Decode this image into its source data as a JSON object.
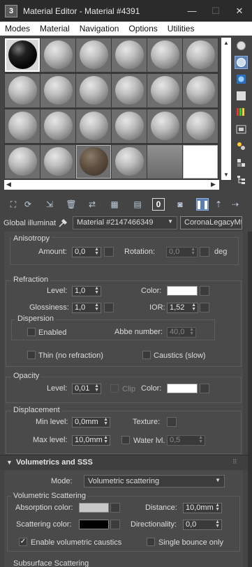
{
  "window": {
    "title": "Material Editor - Material #4391",
    "app_icon": "3",
    "minimize": "—",
    "maximize": "☐",
    "close": "✕"
  },
  "menu": [
    "Modes",
    "Material",
    "Navigation",
    "Options",
    "Utilities"
  ],
  "toolbar": {
    "global_label": "Global illuminat",
    "material_name": "Material #2147466349",
    "material_type": "CoronaLegacyMtl"
  },
  "anisotropy": {
    "title": "Anisotropy",
    "amount_label": "Amount:",
    "amount_value": "0,0",
    "rotation_label": "Rotation:",
    "rotation_value": "0,0",
    "rotation_unit": "deg"
  },
  "refraction": {
    "title": "Refraction",
    "level_label": "Level:",
    "level_value": "1,0",
    "color_label": "Color:",
    "glossiness_label": "Glossiness:",
    "glossiness_value": "1,0",
    "ior_label": "IOR:",
    "ior_value": "1,52",
    "dispersion_title": "Dispersion",
    "enabled_label": "Enabled",
    "abbe_label": "Abbe number:",
    "abbe_value": "40,0",
    "thin_label": "Thin (no refraction)",
    "caustics_label": "Caustics (slow)"
  },
  "opacity": {
    "title": "Opacity",
    "level_label": "Level:",
    "level_value": "0,01",
    "clip_label": "Clip",
    "color_label": "Color:"
  },
  "displacement": {
    "title": "Displacement",
    "min_label": "Min level:",
    "min_value": "0,0mm",
    "texture_label": "Texture:",
    "max_label": "Max level:",
    "max_value": "10,0mm",
    "water_label": "Water lvl.",
    "water_value": "0,5"
  },
  "volumetrics": {
    "title": "Volumetrics and SSS",
    "mode_label": "Mode:",
    "mode_value": "Volumetric scattering",
    "group_title": "Volumetric Scattering",
    "absorption_label": "Absorption color:",
    "distance_label": "Distance:",
    "distance_value": "10,0mm",
    "scattering_label": "Scattering color:",
    "directionality_label": "Directionality:",
    "directionality_value": "0,0",
    "caustics_label": "Enable volumetric caustics",
    "single_bounce_label": "Single bounce only",
    "sss_title": "Subsurface Scattering"
  },
  "colors": {
    "refraction_color": "#ffffff",
    "opacity_color": "#ffffff",
    "absorption_color": "#c8c8c8",
    "scattering_color": "#000000"
  }
}
